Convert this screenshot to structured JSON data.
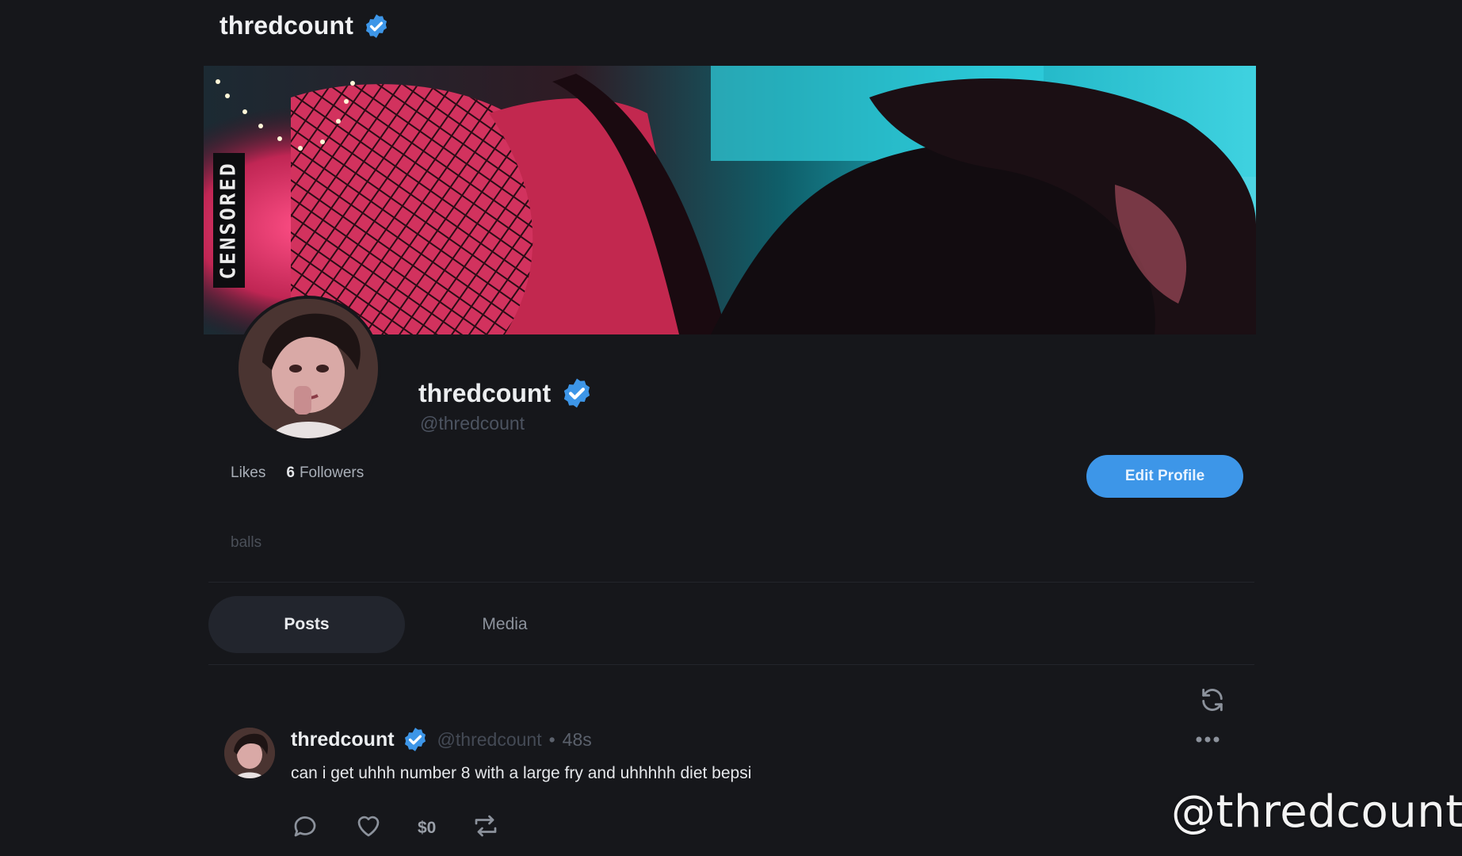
{
  "header": {
    "title": "thredcount"
  },
  "banner": {
    "censor_label": "CENSORED"
  },
  "profile": {
    "display_name": "thredcount",
    "handle": "@thredcount",
    "stats": {
      "likes_label": "Likes",
      "followers_count": "6",
      "followers_label": "Followers"
    },
    "edit_button": "Edit Profile",
    "bio": "balls"
  },
  "tabs": [
    {
      "label": "Posts",
      "active": true
    },
    {
      "label": "Media",
      "active": false
    }
  ],
  "post": {
    "author_name": "thredcount",
    "author_handle": "@thredcount",
    "separator": "•",
    "time": "48s",
    "text": "can i get uhhh number 8 with a large fry and uhhhhh diet bepsi",
    "tip_amount": "$0"
  },
  "watermark": "@thredcount",
  "colors": {
    "accent": "#3d96e8",
    "background": "#16171b",
    "verified": "#3d96e8"
  },
  "icons": [
    "verified-badge-icon",
    "refresh-icon",
    "more-icon",
    "comment-icon",
    "heart-icon",
    "repost-icon"
  ]
}
